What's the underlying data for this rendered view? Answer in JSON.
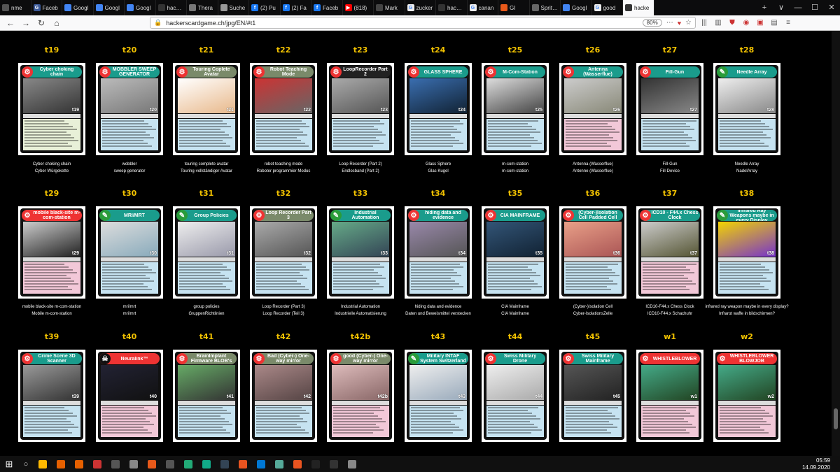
{
  "browser": {
    "tabs": [
      {
        "label": "nme",
        "color": "#555"
      },
      {
        "label": "Faceb",
        "color": "#3b5998",
        "glyph": "G"
      },
      {
        "label": "Googl",
        "color": "#4285f4"
      },
      {
        "label": "Googl",
        "color": "#4285f4"
      },
      {
        "label": "Googl",
        "color": "#4285f4"
      },
      {
        "label": "hackersc",
        "color": "#333"
      },
      {
        "label": "Thera",
        "color": "#777"
      },
      {
        "label": "Suche",
        "color": "#999"
      },
      {
        "label": "(2) Pu",
        "color": "#1877f2",
        "glyph": "f"
      },
      {
        "label": "(2) Fa",
        "color": "#1877f2",
        "glyph": "f"
      },
      {
        "label": "Faceb",
        "color": "#1877f2",
        "glyph": "f"
      },
      {
        "label": "(818)",
        "color": "#ff0000",
        "glyph": "▶"
      },
      {
        "label": "Mark",
        "color": "#444"
      },
      {
        "label": "zucker",
        "color": "#eee",
        "glyph": "G"
      },
      {
        "label": "hackersc",
        "color": "#333"
      },
      {
        "label": "canan",
        "color": "#eee",
        "glyph": "G"
      },
      {
        "label": "GI",
        "color": "#e8591a"
      },
      {
        "label": "Sprites m",
        "color": "#666"
      },
      {
        "label": "Googl",
        "color": "#4285f4"
      },
      {
        "label": "good",
        "color": "#eee",
        "glyph": "G"
      },
      {
        "label": "hacke",
        "color": "#333",
        "active": true
      }
    ],
    "tab_controls": [
      "+",
      "∨",
      "—",
      "☐",
      "✕"
    ],
    "url": "hackerscardgame.ch/jpg/EN/#t1",
    "zoom": "80%"
  },
  "rows": [
    {
      "cards": [
        {
          "id": "t19",
          "title": "Cyber choking chain",
          "caption": [
            "Cyber choking chain",
            "Cyber Würgekette"
          ],
          "head": "#1a9c8c",
          "icon": "#e33",
          "text": "#e8f0d8",
          "img": [
            "#888",
            "#333"
          ]
        },
        {
          "id": "t20",
          "title": "MOBBLER SWEEP GENERATOR",
          "caption": [
            "wobbler",
            "sweep generator"
          ],
          "head": "#1a9c8c",
          "icon": "#e33",
          "text": "#c6e3f1",
          "img": [
            "#bbb",
            "#777"
          ]
        },
        {
          "id": "t21",
          "title": "Touring Coplete Avatar",
          "caption": [
            "touring complete avatar",
            "Touring-vollständiger Avatar"
          ],
          "head": "#7a8a6a",
          "icon": "#e33",
          "text": "#c6e3f1",
          "img": [
            "#fff",
            "#e8b88a"
          ]
        },
        {
          "id": "t22",
          "title": "Robot Teaching Mode",
          "caption": [
            "robot teaching mode",
            "Roboter programmier Modus"
          ],
          "head": "#7a8a6a",
          "icon": "#e33",
          "text": "#c6e3f1",
          "img": [
            "#c33",
            "#666"
          ]
        },
        {
          "id": "t23",
          "title": "LoopRecorder Part 2",
          "caption": [
            "Loop Recorder (Part 2)",
            "Endlosband (Part 2)"
          ],
          "head": "#222",
          "icon": "#e33",
          "text": "#c6e3f1",
          "img": [
            "#aaa",
            "#555"
          ]
        },
        {
          "id": "t24",
          "title": "GLASS SPHERE",
          "caption": [
            "Glass Sphere",
            "Glas Kugel"
          ],
          "head": "#1a9c8c",
          "icon": "#e33",
          "text": "#c6e3f1",
          "img": [
            "#3a6eb0",
            "#123"
          ]
        },
        {
          "id": "t25",
          "title": "M-Com-Station",
          "caption": [
            "m-com-station",
            "m-com-station"
          ],
          "head": "#1a9c8c",
          "icon": "#e33",
          "text": "#c6e3f1",
          "img": [
            "#ddd",
            "#444"
          ]
        },
        {
          "id": "t26",
          "title": "Antenna (Wasserflue)",
          "caption": [
            "Antenna (Wasserflue)",
            "Antenne (Wasserflue)"
          ],
          "head": "#1a9c8c",
          "icon": "#e33",
          "text": "#f2c8d8",
          "img": [
            "#ccc",
            "#887"
          ]
        },
        {
          "id": "t27",
          "title": "Fill-Gun",
          "caption": [
            "Fill-Gun",
            "Fill-Device"
          ],
          "head": "#1a9c8c",
          "icon": "#e33",
          "text": "#c6e3f1",
          "img": [
            "#333",
            "#888"
          ]
        },
        {
          "id": "t28",
          "title": "Needle Array",
          "caption": [
            "Needle Array",
            "NadelArray"
          ],
          "head": "#1a9c8c",
          "icon": "#2a9c3a",
          "text": "#c6e3f1",
          "img": [
            "#eee",
            "#888"
          ]
        }
      ]
    },
    {
      "cards": [
        {
          "id": "t29",
          "title": "mobile black-site m-com-station",
          "caption": [
            "mobile black-site m-com-station",
            "Mobile m-com-station"
          ],
          "head": "#e33",
          "icon": "#e33",
          "text": "#f2c8d8",
          "img": [
            "#ccc",
            "#222"
          ]
        },
        {
          "id": "t30",
          "title": "MRI/MRT",
          "caption": [
            "mri/mrt",
            "mri/mrt"
          ],
          "head": "#1a9c8c",
          "icon": "#2a9c3a",
          "text": "#c6e3f1",
          "img": [
            "#ddd",
            "#8ab"
          ]
        },
        {
          "id": "t31",
          "title": "Group Policies",
          "caption": [
            "group policies",
            "GruppenRichtlinien"
          ],
          "head": "#1a9c8c",
          "icon": "#2a9c3a",
          "text": "#c6e3f1",
          "img": [
            "#eee",
            "#99a"
          ]
        },
        {
          "id": "t32",
          "title": "Loop Recorder Part 3",
          "caption": [
            "Loop Recorder (Part 3)",
            "Loop Recorder (Teil 3)"
          ],
          "head": "#7a8a6a",
          "icon": "#e33",
          "text": "#c6e3f1",
          "img": [
            "#aaa",
            "#555"
          ]
        },
        {
          "id": "t33",
          "title": "Industrial Automation",
          "caption": [
            "Industrial Automation",
            "Industrielle Automatisierung"
          ],
          "head": "#1a9c8c",
          "icon": "#2a9c3a",
          "text": "#c6e3f1",
          "img": [
            "#6a8",
            "#345"
          ]
        },
        {
          "id": "t34",
          "title": "hiding data and evidence",
          "caption": [
            "hiding data and evidence",
            "Daten und Beweismittel verstecken"
          ],
          "head": "#1a9c8c",
          "icon": "#e33",
          "text": "#c6e3f1",
          "img": [
            "#98a",
            "#555"
          ]
        },
        {
          "id": "t35",
          "title": "CIA MAINFRAME",
          "caption": [
            "CIA Mainframe",
            "CIA Mainframe"
          ],
          "head": "#1a9c8c",
          "icon": "#e33",
          "text": "#c6e3f1",
          "img": [
            "#357",
            "#123"
          ]
        },
        {
          "id": "t36",
          "title": "(Cyber-)Isolation Cell Padded Cell",
          "caption": [
            "(Cyber-)Isolation Cell",
            "Cyber-IsolationsZelle"
          ],
          "head": "#1a9c8c",
          "icon": "#e33",
          "text": "#c6e3f1",
          "img": [
            "#e9a088",
            "#a55"
          ]
        },
        {
          "id": "t37",
          "title": "ICD10 - F44.x Chess Clock",
          "caption": [
            "ICD10-F44.x Chess Clock",
            "ICD10-F44.x Schachuhr"
          ],
          "head": "#1a9c8c",
          "icon": "#e33",
          "text": "#f2c8d8",
          "img": [
            "#ccc",
            "#553"
          ]
        },
        {
          "id": "t38",
          "title": "Infrared Ray Weapons maybe in every Display",
          "caption": [
            "infrared ray weapon maybe in every display?",
            "Infrarot waffe in bildschirmen?"
          ],
          "head": "#1a9c8c",
          "icon": "#2a9c3a",
          "text": "#c6e3f1",
          "img": [
            "#f3d400",
            "#73c"
          ]
        }
      ]
    },
    {
      "cards": [
        {
          "id": "t39",
          "title": "Crime Scene 3D Scanner",
          "caption": [],
          "head": "#1a9c8c",
          "icon": "#e33",
          "text": "#c6e3f1",
          "img": [
            "#999",
            "#333"
          ]
        },
        {
          "id": "t40",
          "title": "Neuralink™",
          "caption": [],
          "head": "#e33",
          "icon": "#111",
          "text": "#f2c8d8",
          "img": [
            "#223",
            "#111"
          ]
        },
        {
          "id": "t41",
          "title": "BrainImplant Firmware BLOB's",
          "caption": [],
          "head": "#7a8a6a",
          "icon": "#e33",
          "text": "#c6e3f1",
          "img": [
            "#6a6",
            "#333"
          ]
        },
        {
          "id": "t42",
          "title": "Bad (Cyber-) One-way mirror",
          "caption": [],
          "head": "#7a8a6a",
          "icon": "#e33",
          "text": "#c6e3f1",
          "img": [
            "#a88",
            "#544"
          ]
        },
        {
          "id": "t42b",
          "title": "good (Cyber-) One-way mirror",
          "caption": [],
          "head": "#7a8a6a",
          "icon": "#e33",
          "text": "#f2c8d8",
          "img": [
            "#dbb",
            "#866"
          ]
        },
        {
          "id": "t43",
          "title": "Military INTAF System Switzerland",
          "caption": [],
          "head": "#1a9c8c",
          "icon": "#2a9c3a",
          "text": "#c6e3f1",
          "img": [
            "#eee",
            "#9ab"
          ]
        },
        {
          "id": "t44",
          "title": "Swiss Military Drone",
          "caption": [],
          "head": "#1a9c8c",
          "icon": "#e33",
          "text": "#c6e3f1",
          "img": [
            "#eee",
            "#aaa"
          ]
        },
        {
          "id": "t45",
          "title": "Swiss Military Mainframe",
          "caption": [],
          "head": "#1a9c8c",
          "icon": "#e33",
          "text": "#c6e3f1",
          "img": [
            "#555",
            "#222"
          ]
        },
        {
          "id": "w1",
          "title": "WHISTLEBLOWER",
          "caption": [],
          "head": "#e33",
          "icon": "#e33",
          "text": "#f2c8d8",
          "img": [
            "#4a8",
            "#242"
          ]
        },
        {
          "id": "w2",
          "title": "WHISTLEBLOWER BLOWJOB",
          "caption": [],
          "head": "#e33",
          "icon": "#e33",
          "text": "#f2c8d8",
          "img": [
            "#4a8",
            "#242"
          ]
        }
      ]
    }
  ],
  "taskbar": {
    "icons": [
      "#ffb900",
      "#e66000",
      "#e66000",
      "#c33",
      "#555",
      "#888",
      "#e8591a",
      "#555",
      "#2a7",
      "#1a8",
      "#345",
      "#e95420",
      "#0078d4",
      "#5a9",
      "#e95420",
      "#222",
      "#333",
      "#888"
    ],
    "time": "05:59",
    "date": "14.09.2020"
  }
}
